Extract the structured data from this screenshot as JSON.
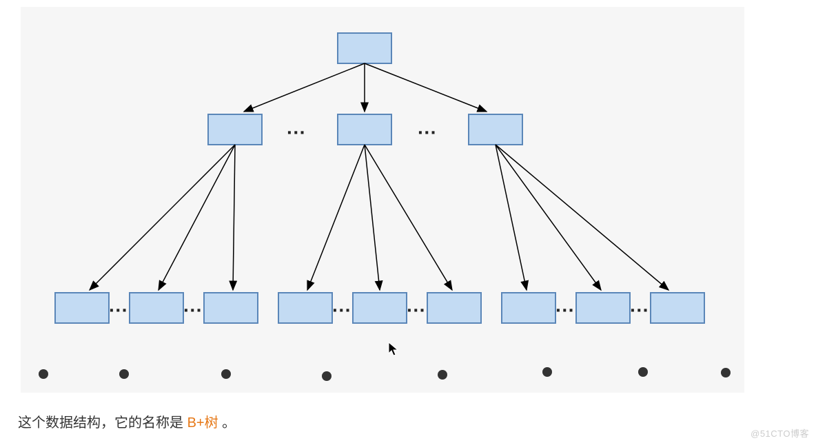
{
  "diagram": {
    "tree_name": "B+树",
    "level1_ellipsis_1": "···",
    "level1_ellipsis_2": "···",
    "leaf_ellipsis": "···"
  },
  "caption": {
    "prefix": "这个数据结构，它的名称是 ",
    "highlight": "B+树",
    "suffix": " 。"
  },
  "watermark": "@51CTO博客",
  "colors": {
    "node_fill": "#c3dbf3",
    "node_stroke": "#5a86b8",
    "highlight": "#e67817",
    "bg": "#f6f6f6"
  }
}
